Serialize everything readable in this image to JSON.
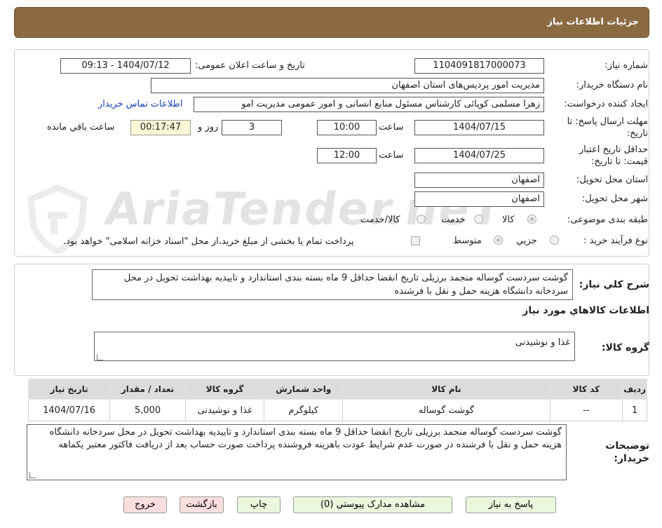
{
  "header": {
    "title": "جزئیات اطلاعات نیاز"
  },
  "form": {
    "need_number_label": "شماره نیاز:",
    "need_number": "1104091817000073",
    "announce_label": "تاریخ و ساعت اعلان عمومی:",
    "announce_value": "1404/07/12 - 09:13",
    "buyer_label": "نام دستگاه خریدار:",
    "buyer_value": "مدیریت امور پردیس‌های استان اصفهان",
    "creator_label": "ایجاد کننده درخواست:",
    "creator_value": "زهرا مسلمی کوپائی کارشناس مسئول منابع انسانی و امور عمومی مدیریت امو",
    "contact_link": "اطلاعات تماس خریدار",
    "deadline_label_1": "مهلت ارسال پاسخ: تا",
    "deadline_label_2": "تاریخ:",
    "deadline_date": "1404/07/15",
    "time_label": "ساعت",
    "deadline_time": "10:00",
    "days_value": "3",
    "days_label": "روز و",
    "remaining_value": "00:17:47",
    "remaining_label": "ساعت باقي مانده",
    "validity_label_1": "حداقل تاریخ اعتبار",
    "validity_label_2": "قیمت: تا تاریخ:",
    "validity_date": "1404/07/25",
    "validity_time": "12:00",
    "province_label": "استان محل تحویل:",
    "province_value": "اصفهان",
    "city_label": "شهر محل تحویل:",
    "city_value": "اصفهان",
    "category_label": "طبقه بندی موضوعی:",
    "category_options": [
      "کالا",
      "خدمت",
      "کالا/خدمت"
    ],
    "process_label": "نوع فرآیند خرید :",
    "process_options": [
      "جزیي",
      "متوسط"
    ],
    "payment_note": "پرداخت تمام یا بخشی از مبلغ خرید،از محل \"اسناد خزانه اسلامی\" خواهد بود."
  },
  "summary": {
    "label": "شرح كلي نياز:",
    "text": "گوشت سردست گوساله منجمد برزیلی تاریخ انقضا حداقل 9 ماه بسته بندی استاندارد و تاییدیه بهداشت تحویل در محل سردخانه دانشگاه هزینه حمل و نقل با فرشنده",
    "goods_info_title": "اطلاعات کالاهاي مورد نياز",
    "goods_group_label": "گروه کالا:",
    "goods_group_value": "غذا و نوشیدنی"
  },
  "table": {
    "headers": [
      "رديف",
      "کد کالا",
      "نام کالا",
      "واحد شمارش",
      "گروه کالا",
      "تعداد / مقدار",
      "تاريخ نياز"
    ],
    "rows": [
      [
        "1",
        "--",
        "گوشت گوساله",
        "کیلوگرم",
        "غذا و نوشیدنی",
        "5,000",
        "1404/07/16"
      ]
    ]
  },
  "buyer_notes": {
    "label_1": "توضيحات",
    "label_2": "خريدار:",
    "text": "گوشت سردست گوساله منجمد برزیلی تاریخ انقضا حداقل 9 ماه بسته بندی استاندارد و تاییدیه بهداشت تحویل در محل سردخانه دانشگاه هزینه حمل و نقل با فرشنده در صورت عدم شرایط عودت باهزینه فروشنده پرداخت صورت حساب بعد از دریافت فاکتور معتبر یکماهه"
  },
  "buttons": {
    "reply": "پاسخ به نیاز",
    "attachments": "مشاهده مدارک پیوستي (0)",
    "print": "چاپ",
    "back": "بازگشت",
    "exit": "خروج"
  },
  "watermark": "AriaTender.neT",
  "colors": {
    "header_bg": "#8b6a42",
    "button_green": "#eaf7dd",
    "button_pink": "#f9dede",
    "remaining_bg": "#fbf7d6"
  }
}
